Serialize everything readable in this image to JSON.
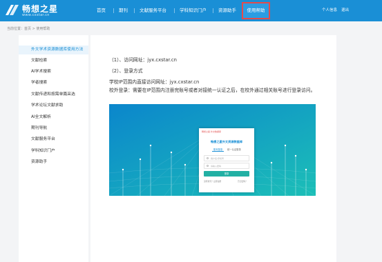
{
  "header": {
    "logo_title": "畅想之星",
    "logo_subtitle": "www.cxstar.cn",
    "nav": [
      "首页",
      "期刊",
      "文献服务平台",
      "学科知识门户",
      "资源助手"
    ],
    "nav_active": "使用帮助",
    "personal_center": "个人信息",
    "logout": "退出"
  },
  "breadcrumb": "当前位置：首页 > 使用帮助",
  "sidebar": {
    "items": [
      "外文学术资源数据库使用方法",
      "文献检索",
      "AI学术搜索",
      "学者搜索",
      "文献传递和按需单篇采选",
      "学术论坛文献求助",
      "AI全文解析",
      "期刊导航",
      "文献服务平台",
      "学科知识门户",
      "资源助手"
    ],
    "active_index": 0
  },
  "content": {
    "line1": "（1）、访问网址：jyx.cxstar.cn",
    "line2": "（2）、登录方式",
    "line3": "学校IP范围内直接访问网址：jyx.cxstar.cn",
    "para": "校外登录：需要在IP范围内注册完账号或者对接统一认证之后，在校外通过相关账号进行登录访问。"
  },
  "embedded_screenshot": {
    "brand": "畅想之星·外文数据库",
    "title": "畅想之星外文资源数据库",
    "tab_account": "账号登录",
    "tab_sso": "统一认证登录",
    "username_placeholder": "用户名/手机号",
    "password_placeholder": "请输入密码",
    "login_button": "登录",
    "register_link": "没有账号？立即注册",
    "forgot_link": "忘记密码？"
  },
  "colors": {
    "header": "#1a8fd6",
    "active_nav_outline": "#e44b4b",
    "sidebar_active_text": "#1a8fd6",
    "login_button": "#22b0a4"
  }
}
